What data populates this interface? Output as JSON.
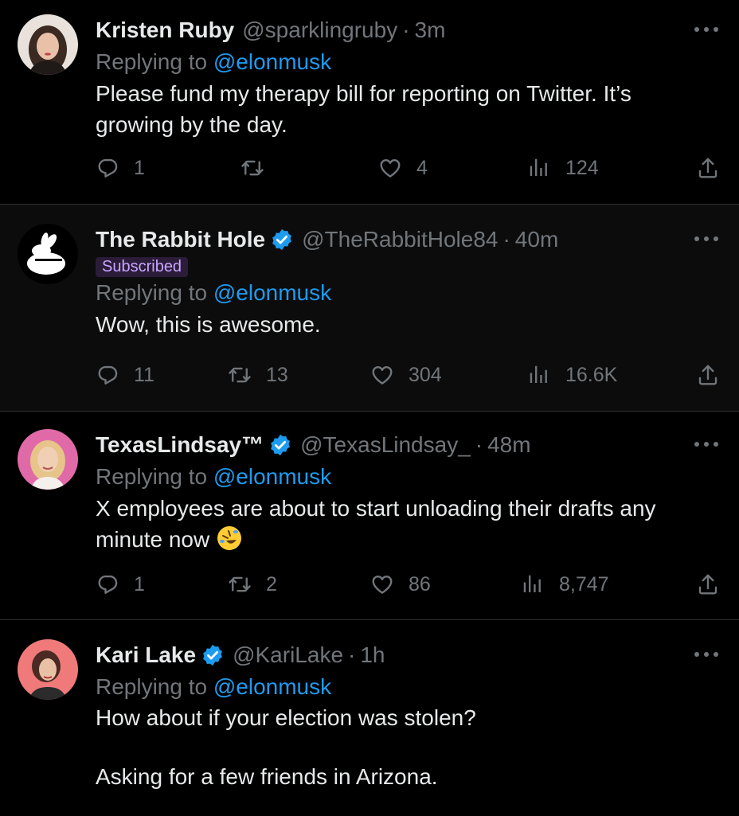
{
  "colors": {
    "background": "#000000",
    "text": "#e7e9ea",
    "muted": "#71767b",
    "link": "#1d9bf0",
    "verified": "#1d9bf0",
    "subscribed_bg": "#2b1c3a",
    "subscribed_text": "#c9a6ff"
  },
  "tweets": [
    {
      "name": "Kristen Ruby",
      "handle": "@sparklingruby",
      "dot": "·",
      "time": "3m",
      "verified": false,
      "reply_prefix": "Replying to",
      "reply_to": "@elonmusk",
      "text_lines": [
        "Please fund my therapy bill for reporting on Twitter. It’s",
        "growing by the day."
      ],
      "replies": "1",
      "retweets": "",
      "likes": "4",
      "views": "124",
      "avatar_icon": "person-photo-icon"
    },
    {
      "name": "The Rabbit Hole",
      "handle": "@TheRabbitHole84",
      "dot": "·",
      "time": "40m",
      "verified": true,
      "badge": "Subscribed",
      "reply_prefix": "Replying to",
      "reply_to": "@elonmusk",
      "text_lines": [
        "Wow, this is awesome."
      ],
      "replies": "11",
      "retweets": "13",
      "likes": "304",
      "views": "16.6K",
      "avatar_icon": "rabbit-logo-icon"
    },
    {
      "name": "TexasLindsay™",
      "handle": "@TexasLindsay_",
      "dot": "·",
      "time": "48m",
      "verified": true,
      "reply_prefix": "Replying to",
      "reply_to": "@elonmusk",
      "text_lines": [
        "X employees are about to start unloading their drafts any",
        "minute now"
      ],
      "replies": "1",
      "retweets": "2",
      "likes": "86",
      "views": "8,747",
      "avatar_icon": "person-photo-icon"
    },
    {
      "name": "Kari Lake",
      "handle": "@KariLake",
      "dot": "·",
      "time": "1h",
      "verified": true,
      "reply_prefix": "Replying to",
      "reply_to": "@elonmusk",
      "text_lines": [
        "How about if your election was stolen?",
        "",
        "Asking for a few friends in Arizona."
      ],
      "avatar_icon": "person-photo-icon"
    }
  ]
}
